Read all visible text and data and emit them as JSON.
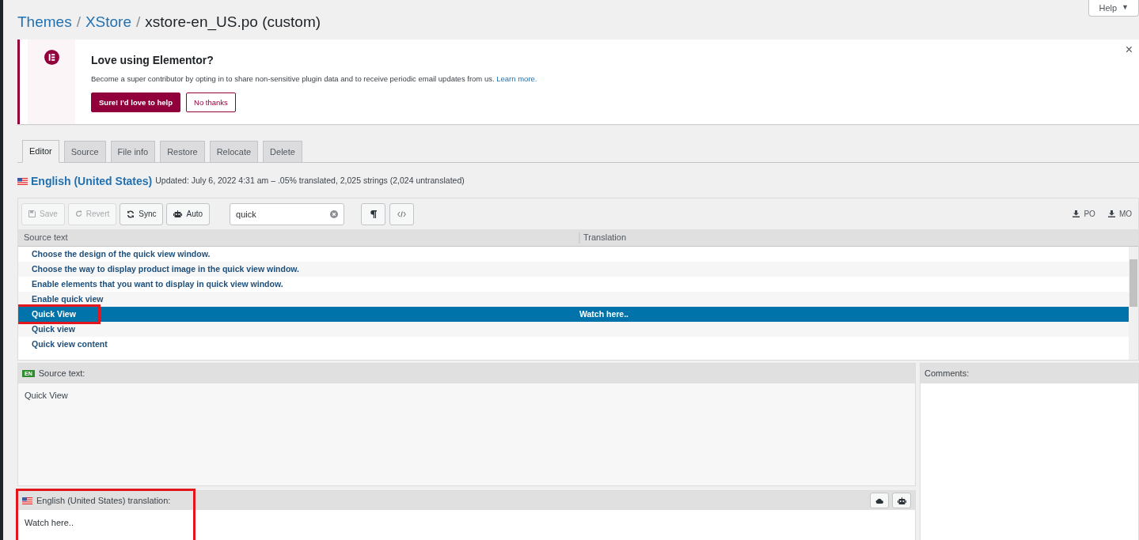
{
  "breadcrumb": [
    {
      "label": "Themes",
      "link": true,
      "separator": "/"
    },
    {
      "label": "XStore",
      "link": true,
      "separator": "/"
    },
    {
      "label": "xstore-en_US.po (custom)",
      "link": false
    }
  ],
  "help_button": {
    "label": "Help",
    "caret": "▼"
  },
  "notice": {
    "title": "Love using Elementor?",
    "text": "Become a super contributor by opting in to share non-sensitive plugin data and to receive periodic email updates from us.",
    "link": "Learn more.",
    "buttons": [
      {
        "label": "Sure! I'd love to help",
        "kind": "primary"
      },
      {
        "label": "No thanks",
        "kind": "secondary"
      }
    ],
    "close": "×"
  },
  "tabs": [
    {
      "label": "Editor",
      "selected": true
    },
    {
      "label": "Source",
      "selected": false
    },
    {
      "label": "File info",
      "selected": false
    },
    {
      "label": "Restore",
      "selected": false
    },
    {
      "label": "Relocate",
      "selected": false
    },
    {
      "label": "Delete",
      "selected": false
    }
  ],
  "locale": {
    "name": "English (United States)",
    "info": "Updated: July 6, 2022 4:31 am – .05% translated, 2,025 strings (2,024 untranslated)"
  },
  "toolbar": {
    "buttons": [
      {
        "label": "Save",
        "disabled": true
      },
      {
        "label": "Revert",
        "disabled": true
      },
      {
        "label": "Sync",
        "disabled": false
      },
      {
        "label": "Auto",
        "disabled": false
      }
    ],
    "search": {
      "value": "quick"
    },
    "downloads": [
      {
        "label": "PO"
      },
      {
        "label": "MO"
      }
    ]
  },
  "table": {
    "columns": [
      "Source text",
      "Translation"
    ],
    "rows": [
      {
        "source": "Choose the design of the quick view window.",
        "translation": "",
        "selected": false,
        "highlighted": false
      },
      {
        "source": "Choose the way to display product image in the quick view window.",
        "translation": "",
        "selected": false,
        "highlighted": false
      },
      {
        "source": "Enable elements that you want to display in quick view window.",
        "translation": "",
        "selected": false,
        "highlighted": false
      },
      {
        "source": "Enable quick view",
        "translation": "",
        "selected": false,
        "highlighted": false
      },
      {
        "source": "Quick View",
        "translation": "Watch here..",
        "selected": true,
        "highlighted": true
      },
      {
        "source": "Quick view",
        "translation": "",
        "selected": false,
        "highlighted": false
      },
      {
        "source": "Quick view content",
        "translation": "",
        "selected": false,
        "highlighted": false
      }
    ]
  },
  "source_pane": {
    "badge": "EN",
    "label": "Source text:",
    "text": "Quick View"
  },
  "translation_pane": {
    "label": "English (United States) translation:",
    "value": "Watch here..",
    "highlighted": true
  },
  "comments_pane": {
    "label": "Comments:"
  }
}
